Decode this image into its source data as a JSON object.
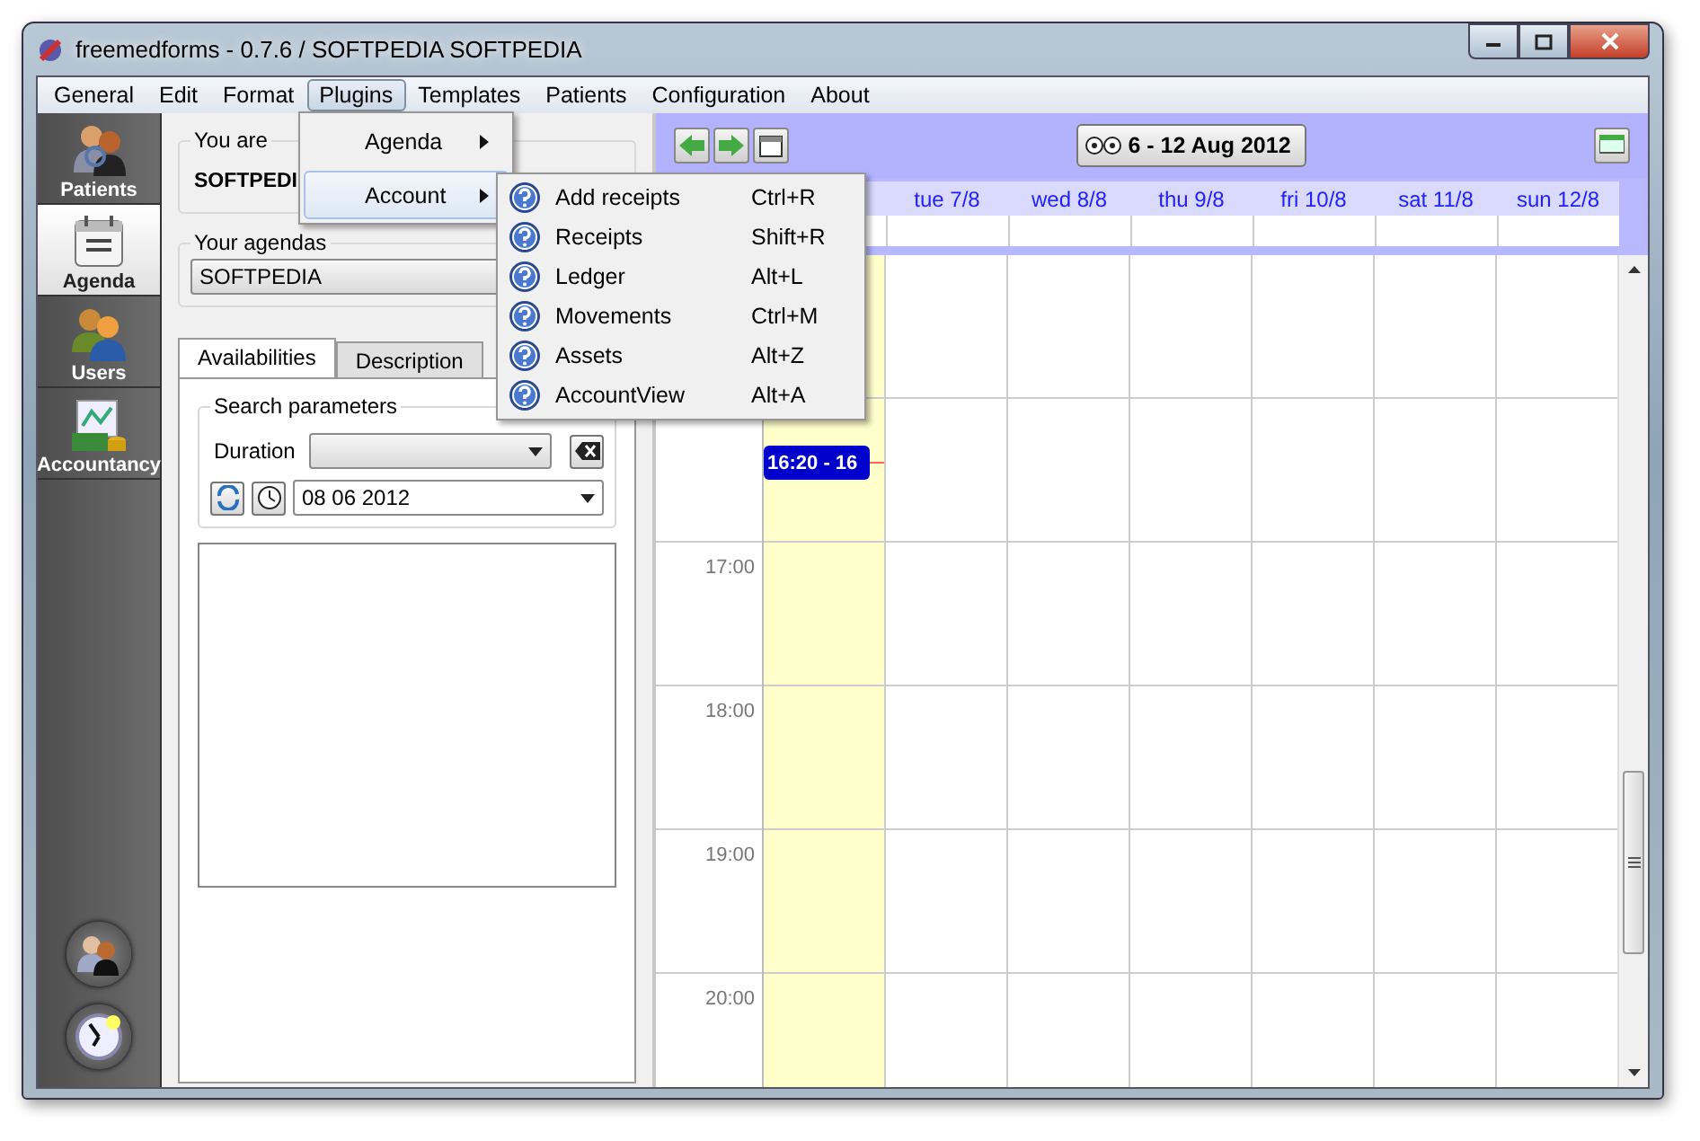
{
  "window": {
    "title": "freemedforms - 0.7.6 /  SOFTPEDIA SOFTPEDIA"
  },
  "menu_bar": [
    {
      "label": "General",
      "selected": false
    },
    {
      "label": "Edit",
      "selected": false
    },
    {
      "label": "Format",
      "selected": false
    },
    {
      "label": "Plugins",
      "selected": true
    },
    {
      "label": "Templates",
      "selected": false
    },
    {
      "label": "Patients",
      "selected": false
    },
    {
      "label": "Configuration",
      "selected": false
    },
    {
      "label": "About",
      "selected": false
    }
  ],
  "plugins_menu": {
    "items": [
      {
        "label": "Agenda",
        "selected": false
      },
      {
        "label": "Account",
        "selected": true
      }
    ]
  },
  "account_menu": {
    "items": [
      {
        "label": "Add receipts",
        "shortcut": "Ctrl+R"
      },
      {
        "label": "Receipts",
        "shortcut": "Shift+R"
      },
      {
        "label": "Ledger",
        "shortcut": "Alt+L"
      },
      {
        "label": "Movements",
        "shortcut": "Ctrl+M"
      },
      {
        "label": "Assets",
        "shortcut": "Alt+Z"
      },
      {
        "label": "AccountView",
        "shortcut": "Alt+A"
      }
    ]
  },
  "sidebar": {
    "items": [
      {
        "label": "Patients",
        "selected": false
      },
      {
        "label": "Agenda",
        "selected": true
      },
      {
        "label": "Users",
        "selected": false
      },
      {
        "label": "Accountancy",
        "selected": false
      }
    ]
  },
  "user_panel": {
    "you_are_label": "You are",
    "user": "SOFTPEDI",
    "agendas_label": "Your agendas",
    "agenda": "SOFTPEDIA"
  },
  "tabs": [
    {
      "label": "Availabilities",
      "selected": true
    },
    {
      "label": "Description",
      "selected": false
    }
  ],
  "search": {
    "title": "Search parameters",
    "duration_label": "Duration",
    "date": "08 06 2012"
  },
  "calendar": {
    "week": "6 - 12 Aug 2012",
    "days": [
      {
        "today": true
      },
      {
        "label": "tue 7/8",
        "today": false
      },
      {
        "label": "wed 8/8",
        "today": false
      },
      {
        "label": "thu 9/8",
        "today": false
      },
      {
        "label": "fri 10/8",
        "today": false
      },
      {
        "label": "sat 11/8",
        "today": false
      },
      {
        "label": "sun 12/8",
        "today": false
      }
    ],
    "times": [
      "17:00",
      "18:00",
      "19:00",
      "20:00"
    ],
    "event": {
      "label": "16:20 - 16"
    }
  }
}
